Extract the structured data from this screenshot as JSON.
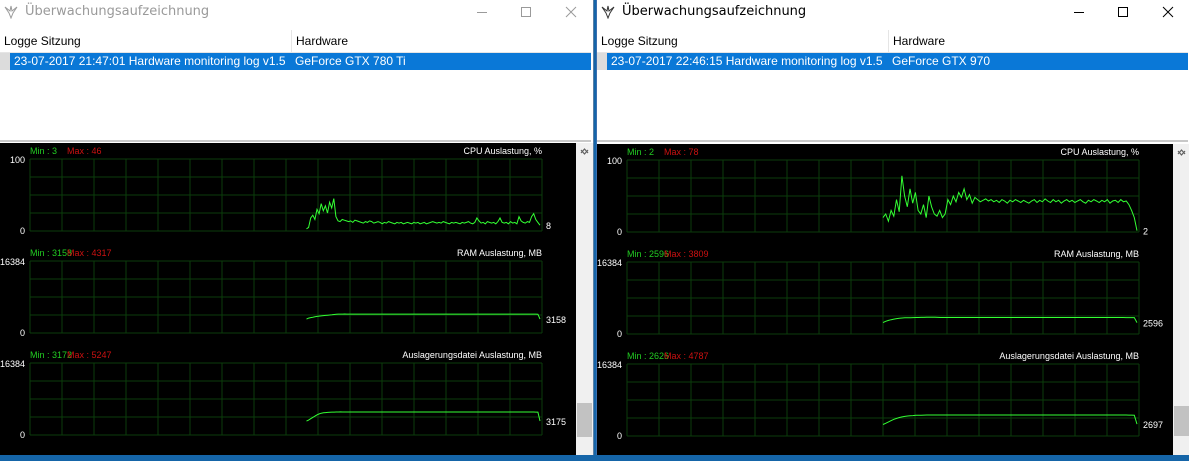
{
  "windows": [
    {
      "id": "left",
      "title": "Überwachungsaufzeichnung",
      "active": false,
      "columns": [
        "Logge Sitzung",
        "Hardware"
      ],
      "row": {
        "session": "23-07-2017 21:47:01 Hardware monitoring log v1.5",
        "hardware": "GeForce GTX 780 Ti"
      },
      "graphs": [
        {
          "title": "CPU Auslastung, %",
          "min_label": "Min : 3",
          "max_label": "Max : 46",
          "ymax": "100",
          "ymin": "0",
          "current": "8",
          "ylim": [
            0,
            100
          ],
          "values": [
            3,
            5,
            18,
            22,
            16,
            30,
            24,
            38,
            28,
            35,
            25,
            40,
            32,
            45,
            20,
            14,
            13,
            16,
            15,
            14,
            13,
            14,
            12,
            15,
            14,
            13,
            12,
            11,
            13,
            12,
            14,
            13,
            11,
            12,
            13,
            12,
            10,
            12,
            11,
            13,
            12,
            11,
            10,
            12,
            11,
            12,
            10,
            11,
            12,
            11,
            10,
            12,
            11,
            12,
            10,
            11,
            12,
            10,
            11,
            12,
            13,
            12,
            11,
            12,
            11,
            13,
            12,
            11,
            10,
            12,
            11,
            12,
            11,
            10,
            12,
            11,
            12,
            13,
            11,
            10,
            12,
            18,
            14,
            11,
            12,
            10,
            13,
            12,
            11,
            12,
            10,
            13,
            18,
            12,
            11,
            12,
            10,
            13,
            11,
            12,
            10,
            20,
            14,
            12,
            11,
            13,
            12,
            20,
            24,
            16,
            12,
            8
          ]
        },
        {
          "title": "RAM Auslastung, MB",
          "min_label": "Min : 3158",
          "max_label": "Max : 4317",
          "ymax": "16384",
          "ymin": "0",
          "current": "3158",
          "ylim": [
            0,
            16384
          ],
          "values": [
            3158,
            3400,
            3500,
            3600,
            3700,
            3780,
            3850,
            3900,
            3950,
            4000,
            4050,
            4100,
            4150,
            4200,
            4250,
            4290,
            4300,
            4310,
            4317,
            4310,
            4300,
            4300,
            4300,
            4300,
            4300,
            4300,
            4300,
            4300,
            4300,
            4300,
            4300,
            4300,
            4300,
            4300,
            4300,
            4300,
            4300,
            4300,
            4300,
            4300,
            4300,
            4300,
            4300,
            4300,
            4300,
            4300,
            4300,
            4300,
            4300,
            4300,
            4300,
            4300,
            4300,
            4300,
            4300,
            4300,
            4300,
            4300,
            4300,
            4300,
            4300,
            4300,
            4300,
            4300,
            4300,
            4300,
            4300,
            4300,
            4300,
            4300,
            4300,
            4300,
            4300,
            4300,
            4300,
            4300,
            4300,
            4300,
            4300,
            4300,
            4300,
            4300,
            4300,
            4300,
            4300,
            4300,
            4300,
            4300,
            4300,
            4300,
            4300,
            4300,
            4300,
            4300,
            4300,
            4300,
            4300,
            4300,
            4300,
            4300,
            4300,
            4300,
            4300,
            4300,
            4300,
            4300,
            4300,
            4300,
            4290,
            4280,
            3158
          ]
        },
        {
          "title": "Auslagerungsdatei Auslastung, MB",
          "min_label": "Min : 3172",
          "max_label": "Max : 5247",
          "ymax": "16384",
          "ymin": "0",
          "current": "3175",
          "ylim": [
            0,
            16384
          ],
          "values": [
            3172,
            3400,
            3700,
            4000,
            4300,
            4600,
            4800,
            4950,
            5050,
            5100,
            5150,
            5180,
            5200,
            5220,
            5230,
            5240,
            5247,
            5245,
            5240,
            5240,
            5240,
            5240,
            5240,
            5240,
            5240,
            5240,
            5240,
            5240,
            5240,
            5240,
            5240,
            5240,
            5240,
            5240,
            5240,
            5240,
            5240,
            5240,
            5240,
            5240,
            5240,
            5240,
            5240,
            5240,
            5240,
            5240,
            5240,
            5240,
            5240,
            5240,
            5240,
            5240,
            5240,
            5240,
            5240,
            5240,
            5240,
            5240,
            5240,
            5240,
            5240,
            5240,
            5240,
            5240,
            5240,
            5240,
            5240,
            5240,
            5240,
            5240,
            5240,
            5240,
            5240,
            5240,
            5240,
            5240,
            5240,
            5240,
            5240,
            5240,
            5240,
            5240,
            5240,
            5240,
            5240,
            5240,
            5240,
            5240,
            5240,
            5240,
            5240,
            5240,
            5240,
            5240,
            5240,
            5240,
            5240,
            5240,
            5240,
            5240,
            5240,
            5240,
            5240,
            5240,
            5240,
            5240,
            5240,
            5230,
            5220,
            5200,
            3175
          ]
        }
      ]
    },
    {
      "id": "right",
      "title": "Überwachungsaufzeichnung",
      "active": true,
      "columns": [
        "Logge Sitzung",
        "Hardware"
      ],
      "row": {
        "session": "23-07-2017 22:46:15 Hardware monitoring log v1.5",
        "hardware": "GeForce GTX 970"
      },
      "graphs": [
        {
          "title": "CPU Auslastung, %",
          "min_label": "Min : 2",
          "max_label": "Max : 78",
          "ymax": "100",
          "ymin": "0",
          "current": "2",
          "ylim": [
            0,
            100
          ],
          "values": [
            20,
            25,
            15,
            30,
            22,
            45,
            28,
            78,
            50,
            35,
            60,
            40,
            55,
            30,
            25,
            38,
            20,
            50,
            35,
            25,
            22,
            30,
            20,
            25,
            45,
            38,
            50,
            42,
            55,
            48,
            60,
            45,
            52,
            40,
            48,
            45,
            42,
            44,
            46,
            43,
            45,
            42,
            44,
            41,
            45,
            43,
            40,
            44,
            42,
            45,
            43,
            41,
            44,
            42,
            40,
            43,
            45,
            41,
            44,
            42,
            46,
            43,
            41,
            45,
            42,
            44,
            40,
            43,
            45,
            42,
            44,
            41,
            43,
            45,
            42,
            40,
            44,
            42,
            45,
            43,
            41,
            44,
            42,
            45,
            40,
            43,
            44,
            41,
            45,
            42,
            43,
            38,
            30,
            20,
            2
          ]
        },
        {
          "title": "RAM Auslastung, MB",
          "min_label": "Min : 2596",
          "max_label": "Max : 3809",
          "ymax": "16384",
          "ymin": "0",
          "current": "2596",
          "ylim": [
            0,
            16384
          ],
          "values": [
            2596,
            2900,
            3100,
            3250,
            3400,
            3500,
            3580,
            3640,
            3680,
            3700,
            3720,
            3740,
            3750,
            3760,
            3770,
            3780,
            3790,
            3800,
            3809,
            3800,
            3780,
            3760,
            3750,
            3750,
            3750,
            3750,
            3750,
            3750,
            3750,
            3750,
            3750,
            3750,
            3750,
            3750,
            3750,
            3750,
            3750,
            3750,
            3750,
            3750,
            3750,
            3750,
            3750,
            3750,
            3750,
            3750,
            3750,
            3750,
            3750,
            3750,
            3750,
            3750,
            3750,
            3750,
            3750,
            3750,
            3750,
            3750,
            3750,
            3750,
            3750,
            3750,
            3750,
            3750,
            3750,
            3750,
            3750,
            3750,
            3750,
            3750,
            3750,
            3750,
            3750,
            3750,
            3750,
            3750,
            3750,
            3750,
            3750,
            3750,
            3750,
            3750,
            3750,
            3750,
            3750,
            3750,
            3750,
            3750,
            3750,
            3740,
            3740,
            3740,
            3740,
            2596
          ]
        },
        {
          "title": "Auslagerungsdatei Auslastung, MB",
          "min_label": "Min : 2626",
          "max_label": "Max : 4787",
          "ymax": "16384",
          "ymin": "0",
          "current": "2697",
          "ylim": [
            0,
            16384
          ],
          "values": [
            2626,
            2900,
            3200,
            3500,
            3800,
            4000,
            4200,
            4350,
            4450,
            4550,
            4600,
            4650,
            4700,
            4720,
            4740,
            4760,
            4770,
            4780,
            4787,
            4780,
            4780,
            4780,
            4780,
            4780,
            4780,
            4780,
            4780,
            4780,
            4780,
            4780,
            4780,
            4780,
            4780,
            4780,
            4780,
            4780,
            4780,
            4780,
            4780,
            4780,
            4780,
            4780,
            4780,
            4780,
            4780,
            4780,
            4780,
            4780,
            4780,
            4780,
            4780,
            4780,
            4780,
            4780,
            4780,
            4780,
            4780,
            4780,
            4780,
            4780,
            4780,
            4780,
            4780,
            4780,
            4780,
            4780,
            4780,
            4780,
            4780,
            4780,
            4780,
            4780,
            4780,
            4780,
            4780,
            4780,
            4780,
            4780,
            4780,
            4780,
            4780,
            4780,
            4780,
            4780,
            4780,
            4780,
            4780,
            4780,
            4780,
            4770,
            4760,
            4750,
            4740,
            2697
          ]
        }
      ]
    }
  ],
  "colors": {
    "grid": "#0b3d0b",
    "line": "#33ff33",
    "min_text": "#22cc22",
    "max_text": "#cc1111",
    "label_text": "#ffffff",
    "selection": "#0a78d7"
  }
}
